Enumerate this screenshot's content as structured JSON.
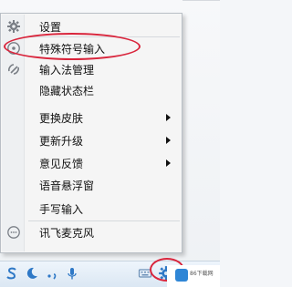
{
  "menu": {
    "items": [
      {
        "label": "设置",
        "icon": "gear-icon",
        "submenu": false
      },
      {
        "label": "特殊符号输入",
        "icon": "special-symbol-icon",
        "submenu": false
      },
      {
        "label": "输入法管理",
        "icon": "ime-manage-icon",
        "submenu": false
      },
      {
        "label": "隐藏状态栏",
        "icon": "",
        "submenu": false
      },
      {
        "label": "更换皮肤",
        "icon": "",
        "submenu": true
      },
      {
        "label": "更新升级",
        "icon": "",
        "submenu": true
      },
      {
        "label": "意见反馈",
        "icon": "",
        "submenu": true
      },
      {
        "label": "语音悬浮窗",
        "icon": "",
        "submenu": false
      },
      {
        "label": "手写输入",
        "icon": "",
        "submenu": false
      },
      {
        "label": "讯飞麦克风",
        "icon": "microphone-icon",
        "submenu": false
      }
    ]
  },
  "taskbar": {
    "icons": [
      "ime-s-icon",
      "moon-icon",
      "punctuation-icon",
      "microphone-icon",
      "keyboard-icon",
      "settings-gear-icon"
    ]
  },
  "watermark": {
    "text": "86下载网"
  },
  "colors": {
    "annotation": "#d9253c",
    "accent": "#2e78c6"
  }
}
